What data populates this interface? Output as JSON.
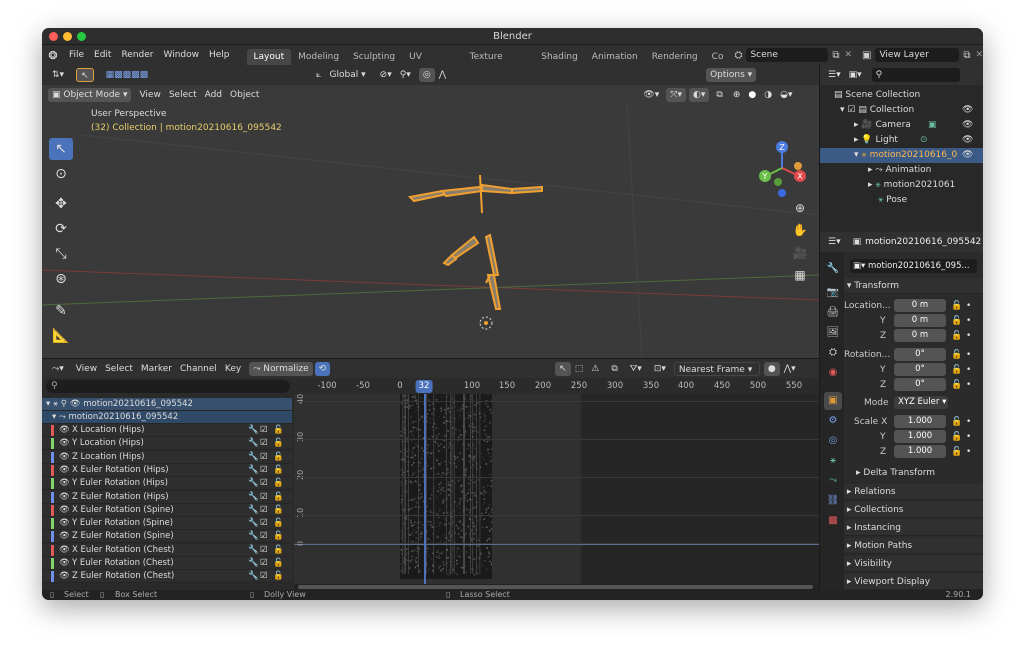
{
  "window": {
    "title": "Blender"
  },
  "menu": {
    "file": "File",
    "edit": "Edit",
    "render": "Render",
    "window": "Window",
    "help": "Help"
  },
  "workspaces": [
    "Layout",
    "Modeling",
    "Sculpting",
    "UV Editing",
    "Texture Paint",
    "Shading",
    "Animation",
    "Rendering",
    "Co"
  ],
  "scene": {
    "name": "Scene",
    "view_layer": "View Layer"
  },
  "viewport": {
    "transform_orientation": "Global",
    "options": "Options",
    "mode": "Object Mode",
    "menus": [
      "View",
      "Select",
      "Add",
      "Object"
    ],
    "overlay_title": "User Perspective",
    "overlay_sub": "(32) Collection | motion20210616_095542",
    "gizmo": {
      "z": "Z",
      "y": "Y",
      "x": "X"
    }
  },
  "graph": {
    "menus": [
      "View",
      "Select",
      "Marker",
      "Channel",
      "Key"
    ],
    "normalize": "Normalize",
    "snap": "Nearest Frame",
    "frame_ticks": [
      "-100",
      "-50",
      "0",
      "32",
      "100",
      "150",
      "200",
      "250",
      "300",
      "350",
      "400",
      "450",
      "500",
      "550"
    ],
    "current_frame": "32",
    "value_ticks": [
      "40",
      "30",
      "20",
      "10",
      "0"
    ],
    "object": "motion20210616_095542",
    "action": "motion20210616_095542",
    "channels": [
      {
        "name": "X Location (Hips)",
        "color": "#e05a5a"
      },
      {
        "name": "Y Location (Hips)",
        "color": "#7fd46a"
      },
      {
        "name": "Z Location (Hips)",
        "color": "#6f8fe8"
      },
      {
        "name": "X Euler Rotation (Hips)",
        "color": "#e05a5a"
      },
      {
        "name": "Y Euler Rotation (Hips)",
        "color": "#7fd46a"
      },
      {
        "name": "Z Euler Rotation (Hips)",
        "color": "#6f8fe8"
      },
      {
        "name": "X Euler Rotation (Spine)",
        "color": "#e05a5a"
      },
      {
        "name": "Y Euler Rotation (Spine)",
        "color": "#7fd46a"
      },
      {
        "name": "Z Euler Rotation (Spine)",
        "color": "#6f8fe8"
      },
      {
        "name": "X Euler Rotation (Chest)",
        "color": "#e05a5a"
      },
      {
        "name": "Y Euler Rotation (Chest)",
        "color": "#7fd46a"
      },
      {
        "name": "Z Euler Rotation (Chest)",
        "color": "#6f8fe8"
      }
    ]
  },
  "outliner": {
    "root": "Scene Collection",
    "items": [
      {
        "label": "Collection"
      },
      {
        "label": "Camera"
      },
      {
        "label": "Light"
      },
      {
        "label": "motion20210616_0"
      },
      {
        "label": "Animation"
      },
      {
        "label": "motion2021061"
      },
      {
        "label": "Pose"
      }
    ]
  },
  "properties": {
    "object_name": "motion20210616_095542",
    "object_field": "motion20210616_095...",
    "transform": "Transform",
    "location_label": "Location...",
    "rotation_label": "Rotation...",
    "scale_label": "Scale X",
    "y": "Y",
    "z": "Z",
    "loc": [
      "0 m",
      "0 m",
      "0 m"
    ],
    "rot": [
      "0°",
      "0°",
      "0°"
    ],
    "mode_label": "Mode",
    "mode": "XYZ Euler",
    "scale": [
      "1.000",
      "1.000",
      "1.000"
    ],
    "sections": [
      "Delta Transform",
      "Relations",
      "Collections",
      "Instancing",
      "Motion Paths",
      "Visibility",
      "Viewport Display"
    ]
  },
  "statusbar": {
    "select": "Select",
    "box_select": "Box Select",
    "dolly": "Dolly View",
    "lasso": "Lasso Select",
    "version": "2.90.1"
  }
}
